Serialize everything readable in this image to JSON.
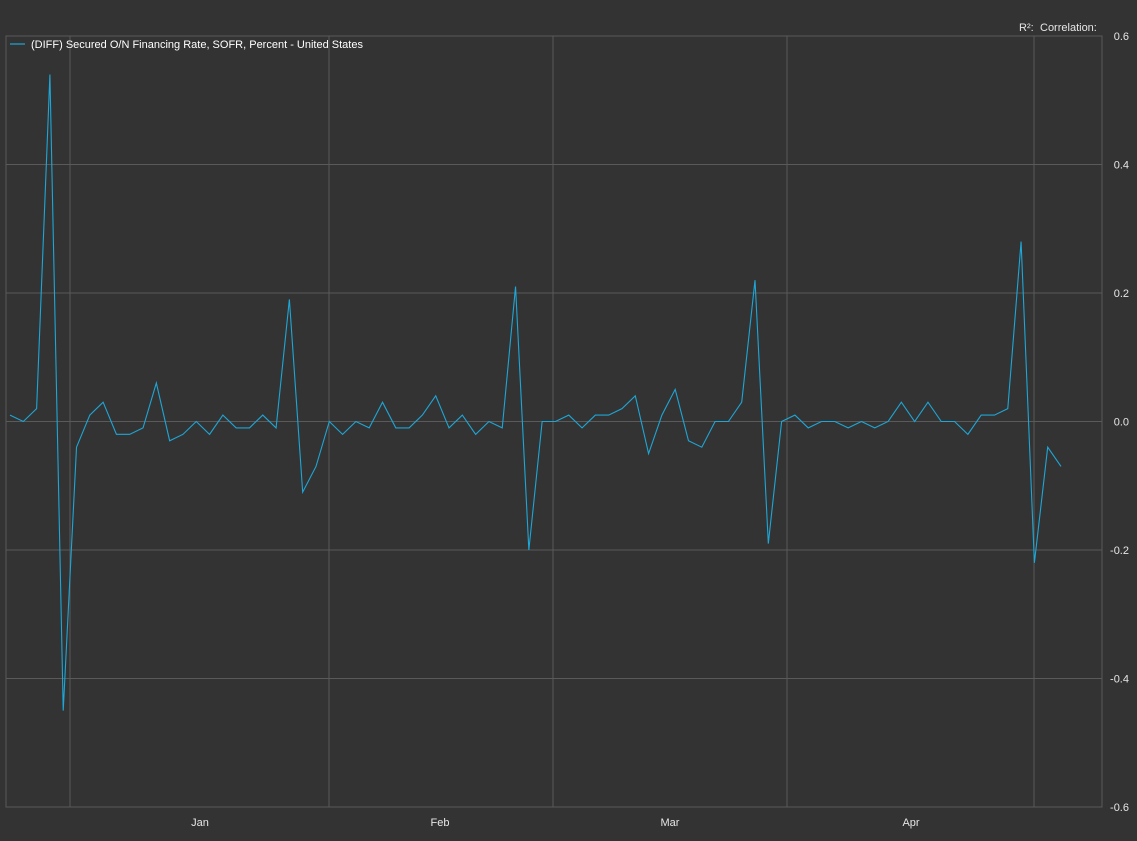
{
  "chart_data": {
    "type": "line",
    "series": [
      {
        "name": "(DIFF) Secured O/N Financing Rate, SOFR, Percent - United States",
        "color": "#1ea6d6",
        "values": [
          0.01,
          0.0,
          0.02,
          0.54,
          -0.45,
          -0.04,
          0.01,
          0.03,
          -0.02,
          -0.02,
          -0.01,
          0.06,
          -0.03,
          -0.02,
          0.0,
          -0.02,
          0.01,
          -0.01,
          -0.01,
          0.01,
          -0.01,
          0.19,
          -0.11,
          -0.07,
          0.0,
          -0.02,
          0.0,
          -0.01,
          0.03,
          -0.01,
          -0.01,
          0.01,
          0.04,
          -0.01,
          0.01,
          -0.02,
          0.0,
          -0.01,
          0.21,
          -0.2,
          0.0,
          0.0,
          0.01,
          -0.01,
          0.01,
          0.01,
          0.02,
          0.04,
          -0.05,
          0.01,
          0.05,
          -0.03,
          -0.04,
          0.0,
          0.0,
          0.03,
          0.22,
          -0.19,
          0.0,
          0.01,
          -0.01,
          0.0,
          0.0,
          -0.01,
          0.0,
          -0.01,
          0.0,
          0.03,
          0.0,
          0.03,
          0.0,
          0.0,
          -0.02,
          0.01,
          0.01,
          0.02,
          0.28,
          -0.22,
          -0.04,
          -0.07
        ]
      }
    ],
    "x_tick_labels": [
      "Jan",
      "Feb",
      "Mar",
      "Apr"
    ],
    "y_tick_labels": [
      "0.6",
      "0.4",
      "0.2",
      "0.0",
      "-0.2",
      "-0.4",
      "-0.6"
    ],
    "ylim": [
      -0.6,
      0.6
    ],
    "y_ticks": [
      0.6,
      0.4,
      0.2,
      0.0,
      -0.2,
      -0.4,
      -0.6
    ],
    "legend_position": "top-left",
    "grid": true,
    "stats_labels": {
      "r_squared": "R²:",
      "correlation": "Correlation:"
    },
    "colors": {
      "background": "#333333",
      "grid": "#5a5a5a",
      "line": "#1ea6d6",
      "text": "#e6e6e6"
    }
  }
}
